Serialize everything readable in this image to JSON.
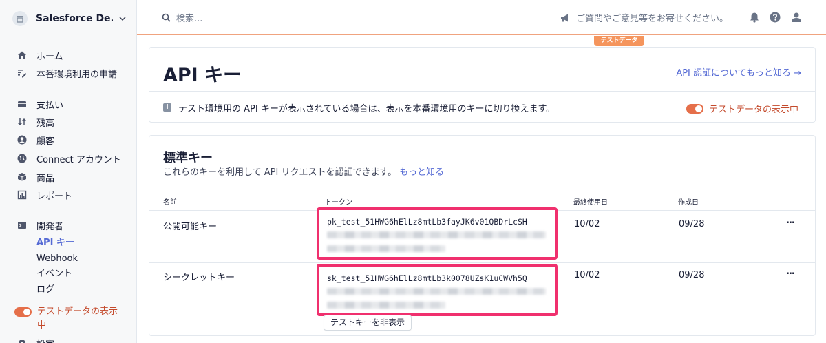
{
  "sidebar": {
    "account_name": "Salesforce De...",
    "items": [
      {
        "label": "ホーム",
        "icon": "home-icon"
      },
      {
        "label": "本番環境利用の申請",
        "icon": "pencil-list-icon"
      },
      {
        "label": "支払い",
        "icon": "wallet-icon"
      },
      {
        "label": "残高",
        "icon": "arrows-icon"
      },
      {
        "label": "顧客",
        "icon": "user-circle-icon"
      },
      {
        "label": "Connect アカウント",
        "icon": "globe-icon"
      },
      {
        "label": "商品",
        "icon": "box-icon"
      },
      {
        "label": "レポート",
        "icon": "report-icon"
      },
      {
        "label": "開発者",
        "icon": "terminal-icon"
      }
    ],
    "developer_sub": [
      "API キー",
      "Webhook",
      "イベント",
      "ログ"
    ],
    "test_toggle_label": "テストデータの表示中",
    "settings_label": "設定"
  },
  "topbar": {
    "search_placeholder": "検索...",
    "feedback": "ご質問やご意見等をお寄せください。",
    "test_badge": "テストデータ"
  },
  "header": {
    "title": "API キー",
    "doc_link": "API 認証についてもっと知る →",
    "info": "テスト環境用の API キーが表示されている場合は、表示を本番環境用のキーに切り換えます。",
    "toggle_label": "テストデータの表示中"
  },
  "standard_keys": {
    "title": "標準キー",
    "description": "これらのキーを利用して API リクエストを認証できます。",
    "learn_more": "もっと知る",
    "columns": [
      "名前",
      "トークン",
      "最終使用日",
      "作成日"
    ],
    "rows": [
      {
        "name": "公開可能キー",
        "token": "pk_test_51HWG6hElLz8mtLb3fayJK6v01QBDrLcSH",
        "last_used": "10/02",
        "created": "09/28",
        "menu": "..."
      },
      {
        "name": "シークレットキー",
        "token": "sk_test_51HWG6hElLz8mtLb3k0078UZsK1uCWVh5Q",
        "last_used": "10/02",
        "created": "09/28",
        "menu": "..."
      }
    ],
    "hide_button": "テストキーを非表示"
  },
  "colors": {
    "accent": "#5469d4",
    "test_orange": "#e56f4a",
    "highlight_border": "#f0306e"
  }
}
